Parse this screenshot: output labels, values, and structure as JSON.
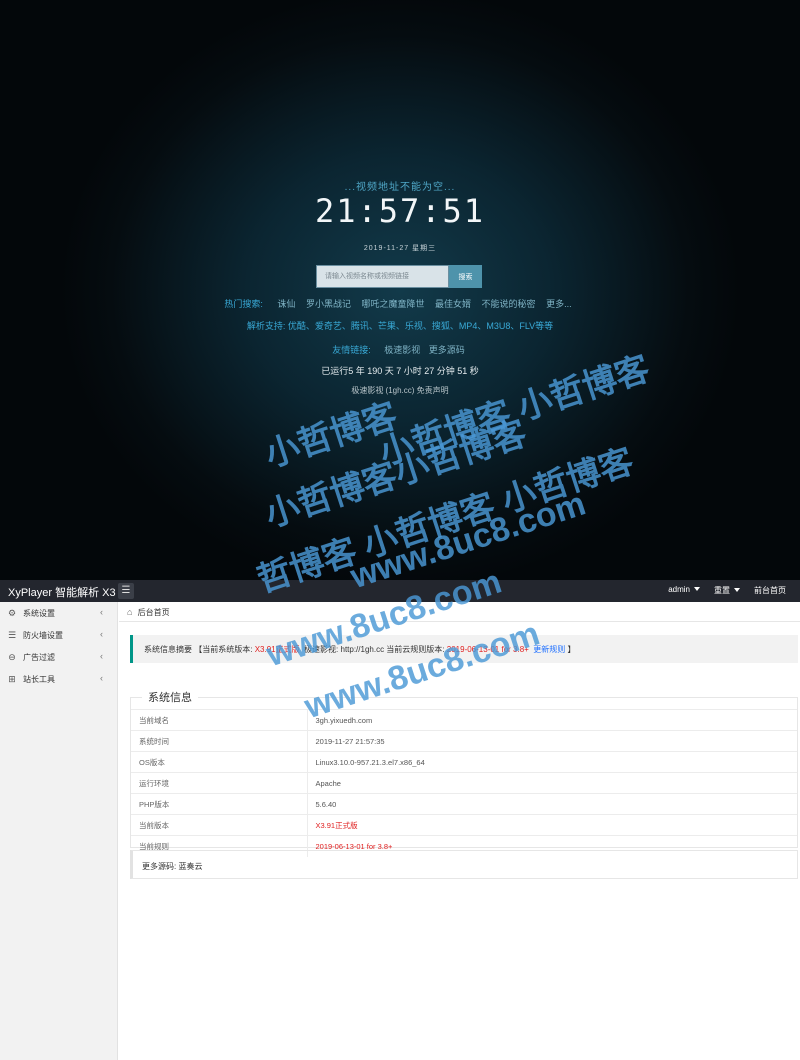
{
  "front": {
    "notice": "...视频地址不能为空...",
    "clock": "21:57:51",
    "date": "2019-11-27 星期三",
    "search_placeholder": "请输入视频名称或视频链接",
    "search_button": "搜索",
    "hot_label": "热门搜索:",
    "hot_items": [
      "诛仙",
      "罗小黑战记",
      "哪吒之魔童降世",
      "最佳女婿",
      "不能说的秘密",
      "更多..."
    ],
    "support_text": "解析支持: 优酷、爱奇艺、腾讯、芒果、乐视、搜狐、MP4、M3U8、FLV等等",
    "friend_label": "友情链接:",
    "friend_items": [
      "极速影视",
      "更多源码"
    ],
    "runtime": "已运行5 年 190 天 7 小时 27 分钟 51 秒",
    "site": "极速影视 (1gh.cc) 免责声明"
  },
  "admin": {
    "brand": "XyPlayer 智能解析 X3",
    "menu_toggle_icon": "list-icon",
    "top_right": {
      "user": "admin",
      "reset": "重置",
      "home": "前台首页"
    },
    "sidebar": [
      {
        "label": "系统设置",
        "icon": "gear-icon"
      },
      {
        "label": "防火墙设置",
        "icon": "list-icon"
      },
      {
        "label": "广告过滤",
        "icon": "filter-icon"
      },
      {
        "label": "站长工具",
        "icon": "grid-icon"
      }
    ],
    "breadcrumb": "后台首页",
    "summary": {
      "prefix": "系统信息摘要 【当前系统版本:",
      "version": "X3.91正式版",
      "mid": "极速影视: http://1gh.cc 当前云规则版本:",
      "rule": "2019-06-13-01 for 3.8+",
      "update": "更新规则",
      "suffix": "】"
    },
    "info_title": "系统信息",
    "info_rows": [
      {
        "key": "当前域名",
        "value": "3gh.yixuedh.com",
        "red": false
      },
      {
        "key": "系统时间",
        "value": "2019-11-27 21:57:35",
        "red": false
      },
      {
        "key": "OS版本",
        "value": "Linux3.10.0-957.21.3.el7.x86_64",
        "red": false
      },
      {
        "key": "运行环境",
        "value": "Apache",
        "red": false
      },
      {
        "key": "PHP版本",
        "value": "5.6.40",
        "red": false
      },
      {
        "key": "当前版本",
        "value": "X3.91正式版",
        "red": true
      },
      {
        "key": "当前规则",
        "value": "2019-06-13-01 for 3.8+",
        "red": true
      }
    ],
    "more_source": "更多源码: 蓝奏云"
  },
  "watermark": {
    "line1": "小哲博客",
    "line2": "小哲博客小哲博客",
    "line3": "小哲博客 小哲博客",
    "line4": "哲博客 小哲博客 小哲博客",
    "line5": "www.8uc8.com",
    "line6": "www.8uc8.com",
    "line7": "www.8uc8.com"
  }
}
